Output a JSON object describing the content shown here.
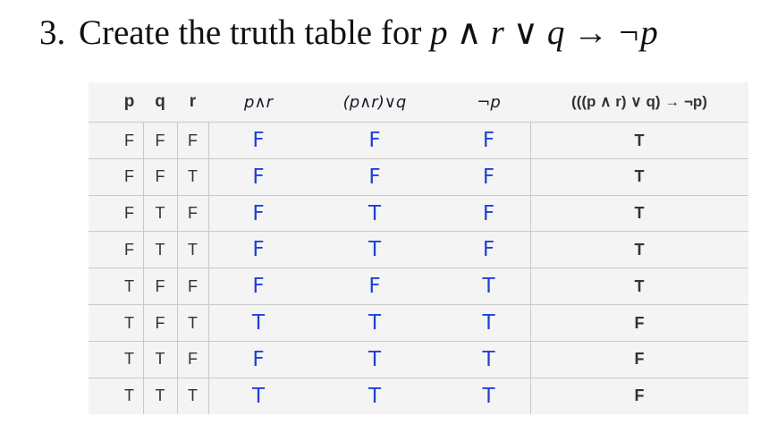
{
  "title": {
    "number": "3.",
    "text": "Create the truth table for ",
    "p": "p",
    "and": "∧",
    "r": "r",
    "or": "∨",
    "q": "q",
    "implies": "→",
    "notp": "¬p"
  },
  "table": {
    "headers": {
      "p": "p",
      "q": "q",
      "r": "r",
      "p_and_r": "p∧r",
      "p_and_r_or_q": "(p∧r)∨q",
      "not_p": "¬p",
      "result": "(((p ∧ r) ∨ q) → ¬p)"
    },
    "rows": [
      {
        "p": "F",
        "q": "F",
        "r": "F",
        "p_and_r": "F",
        "p_and_r_or_q": "F",
        "not_p": "F",
        "result": "T"
      },
      {
        "p": "F",
        "q": "F",
        "r": "T",
        "p_and_r": "F",
        "p_and_r_or_q": "F",
        "not_p": "F",
        "result": "T"
      },
      {
        "p": "F",
        "q": "T",
        "r": "F",
        "p_and_r": "F",
        "p_and_r_or_q": "T",
        "not_p": "F",
        "result": "T"
      },
      {
        "p": "F",
        "q": "T",
        "r": "T",
        "p_and_r": "F",
        "p_and_r_or_q": "T",
        "not_p": "F",
        "result": "T"
      },
      {
        "p": "T",
        "q": "F",
        "r": "F",
        "p_and_r": "F",
        "p_and_r_or_q": "F",
        "not_p": "T",
        "result": "T"
      },
      {
        "p": "T",
        "q": "F",
        "r": "T",
        "p_and_r": "T",
        "p_and_r_or_q": "T",
        "not_p": "T",
        "result": "F"
      },
      {
        "p": "T",
        "q": "T",
        "r": "F",
        "p_and_r": "F",
        "p_and_r_or_q": "T",
        "not_p": "T",
        "result": "F"
      },
      {
        "p": "T",
        "q": "T",
        "r": "T",
        "p_and_r": "T",
        "p_and_r_or_q": "T",
        "not_p": "T",
        "result": "F"
      }
    ]
  },
  "colors": {
    "handwriting_ink": "#1f3fd6",
    "table_background": "#f4f4f4",
    "grid_line": "#c8c8c8"
  }
}
